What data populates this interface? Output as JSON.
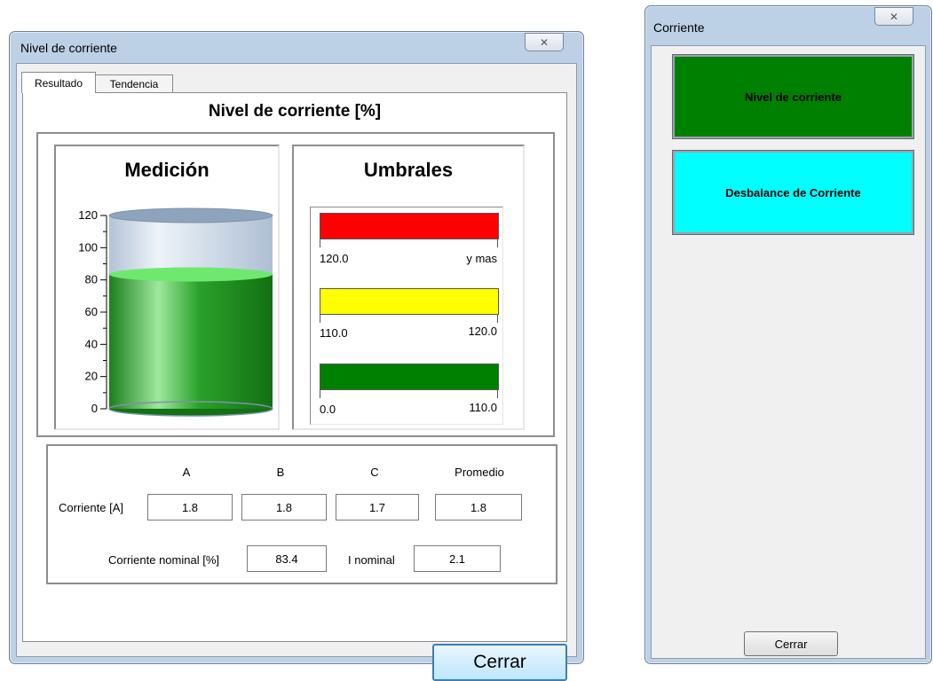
{
  "win1": {
    "title": "Nivel de corriente",
    "tabs": [
      {
        "label": "Resultado"
      },
      {
        "label": "Tendencia"
      }
    ],
    "panel_title": "Nivel de corriente [%]",
    "medicion": {
      "title": "Medición",
      "scale_ticks": [
        "120",
        "100",
        "80",
        "60",
        "40",
        "20",
        "0"
      ],
      "level_value": 83.4,
      "scale_max": 120,
      "colors": {
        "fill": "#2aa12a",
        "fill_top": "#6fe86f",
        "empty": "#cdd9e6",
        "cap": "#8ea4bc"
      }
    },
    "umbrales": {
      "title": "Umbrales",
      "bands": [
        {
          "color": "#ff0000",
          "from": "120.0",
          "to": "y mas"
        },
        {
          "color": "#ffff00",
          "from": "110.0",
          "to": "120.0"
        },
        {
          "color": "#008000",
          "from": "0.0",
          "to": "110.0"
        }
      ]
    },
    "table": {
      "columns": [
        "A",
        "B",
        "C",
        "Promedio"
      ],
      "row_label": "Corriente [A]",
      "values": [
        "1.8",
        "1.8",
        "1.7",
        "1.8"
      ],
      "nominal_pct_label": "Corriente nominal [%]",
      "nominal_pct_value": "83.4",
      "i_nominal_label": "I nominal",
      "i_nominal_value": "2.1"
    },
    "close_label": "Cerrar",
    "close_icon": "close-x-icon"
  },
  "win2": {
    "title": "Corriente",
    "buttons": [
      {
        "label": "Nivel de corriente",
        "color": "#008000"
      },
      {
        "label": "Desbalance de Corriente",
        "color": "#00ffff"
      }
    ],
    "close_label": "Cerrar",
    "close_icon": "close-x-icon"
  }
}
